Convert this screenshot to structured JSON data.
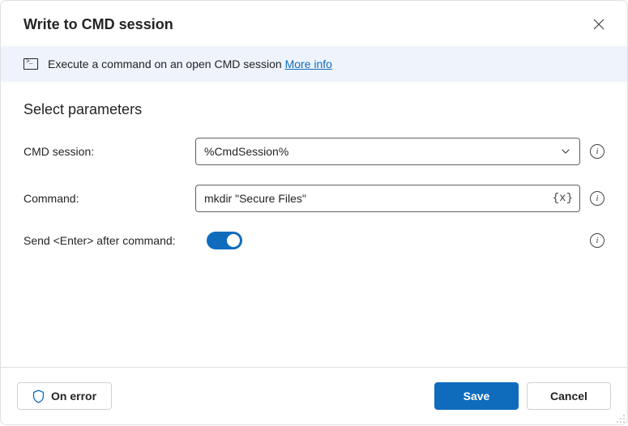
{
  "header": {
    "title": "Write to CMD session"
  },
  "banner": {
    "text": "Execute a command on an open CMD session ",
    "link": "More info"
  },
  "section": {
    "title": "Select parameters"
  },
  "fields": {
    "cmd_session": {
      "label": "CMD session:",
      "value": "%CmdSession%"
    },
    "command": {
      "label": "Command:",
      "value": "mkdir \"Secure Files\""
    },
    "send_enter": {
      "label": "Send <Enter> after command:",
      "enabled": true
    }
  },
  "footer": {
    "on_error": "On error",
    "save": "Save",
    "cancel": "Cancel"
  }
}
